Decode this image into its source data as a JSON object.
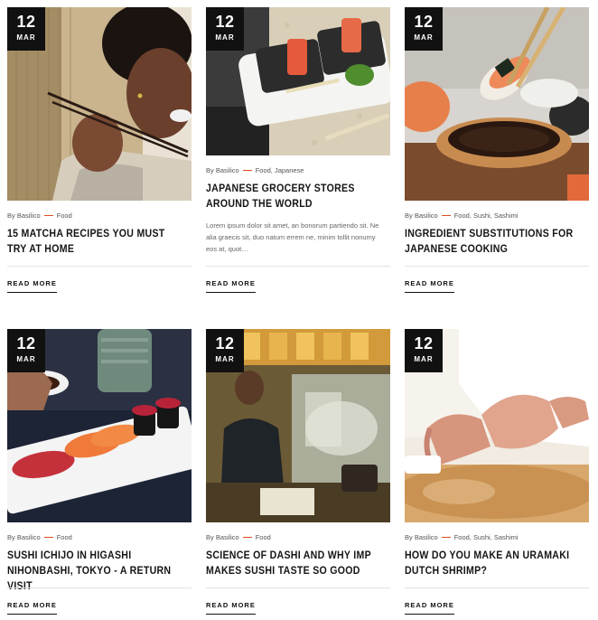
{
  "posts": [
    {
      "day": "12",
      "month": "MAR",
      "author": "By Basilico",
      "categories": "Food",
      "title": "15 Matcha Recipes You Must Try At Home",
      "excerpt": "",
      "read_more": "READ MORE",
      "image": "woman-eating-with-chopsticks"
    },
    {
      "day": "12",
      "month": "MAR",
      "author": "By Basilico",
      "categories": "Food, Japanese",
      "title": "Japanese Grocery Stores Around The World",
      "excerpt": "Lorem ipsum dolor sit amet, an bonorum partiendo sit. Ne alia graecis sit, duo natum errem ne, minim tollit nonumy eos at, quot…",
      "read_more": "READ MORE",
      "image": "sashimi-plates"
    },
    {
      "day": "12",
      "month": "MAR",
      "author": "By Basilico",
      "categories": "Food, Sushi, Sashimi",
      "title": "Ingredient Substitutions For Japanese Cooking",
      "excerpt": "",
      "read_more": "READ MORE",
      "image": "sushi-dipping-soy-sauce"
    },
    {
      "day": "12",
      "month": "MAR",
      "author": "By Basilico",
      "categories": "Food",
      "title": "Sushi Ichijo In Higashi Nihonbashi, Tokyo - A Return Visit",
      "excerpt": "",
      "read_more": "READ MORE",
      "image": "nigiri-sushi-plate"
    },
    {
      "day": "12",
      "month": "MAR",
      "author": "By Basilico",
      "categories": "Food",
      "title": "Science Of Dashi And Why IMP Makes Sushi Taste So Good",
      "excerpt": "",
      "read_more": "READ MORE",
      "image": "chef-in-kitchen"
    },
    {
      "day": "12",
      "month": "MAR",
      "author": "By Basilico",
      "categories": "Food, Sushi, Sashimi",
      "title": "How Do You Make An Uramaki Dutch Shrimp?",
      "excerpt": "",
      "read_more": "READ MORE",
      "image": "hands-making-sushi"
    }
  ],
  "colors": {
    "badge_bg": "#111111",
    "accent_dash": "#e04a1f",
    "title": "#151515"
  }
}
